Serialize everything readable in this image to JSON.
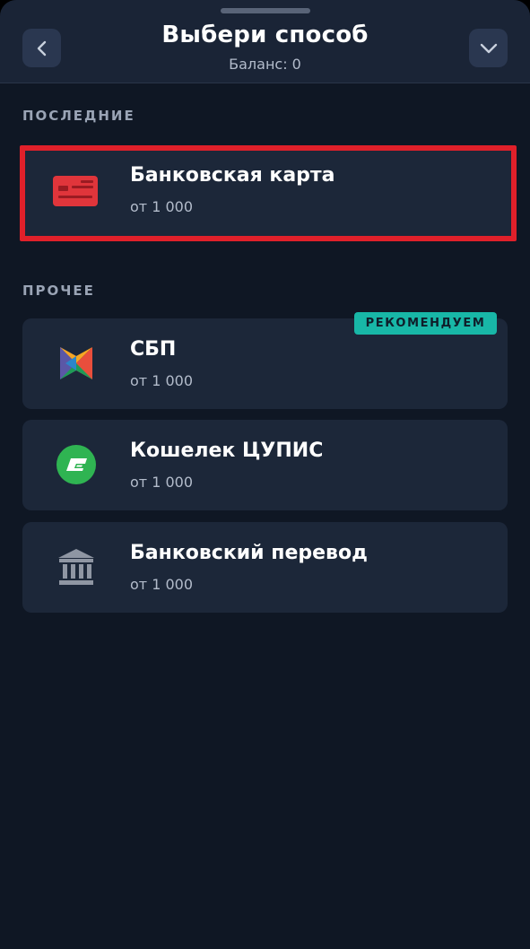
{
  "header": {
    "title": "Выбери способ",
    "balance": "Баланс: 0"
  },
  "sections": {
    "recent_label": "ПОСЛЕДНИЕ",
    "other_label": "ПРОЧЕЕ"
  },
  "methods": [
    {
      "name": "Банковская карта",
      "min": "от 1 000",
      "icon": "credit-card-icon",
      "section": "recent",
      "selected": true
    },
    {
      "name": "СБП",
      "min": "от 1 000",
      "icon": "sbp-logo-icon",
      "section": "other",
      "badge": "РЕКОМЕНДУЕМ"
    },
    {
      "name": "Кошелек ЦУПИС",
      "min": "от 1 000",
      "icon": "cupis-wallet-icon",
      "section": "other"
    },
    {
      "name": "Банковский перевод",
      "min": "от 1 000",
      "icon": "bank-building-icon",
      "section": "other"
    }
  ],
  "colors": {
    "background": "#0f1724",
    "header": "#1a2436",
    "card": "#1c2739",
    "selection_border": "#e0202a",
    "badge": "#18b7a7",
    "card_icon": "#e0353b",
    "cupis_green": "#2fb452"
  }
}
